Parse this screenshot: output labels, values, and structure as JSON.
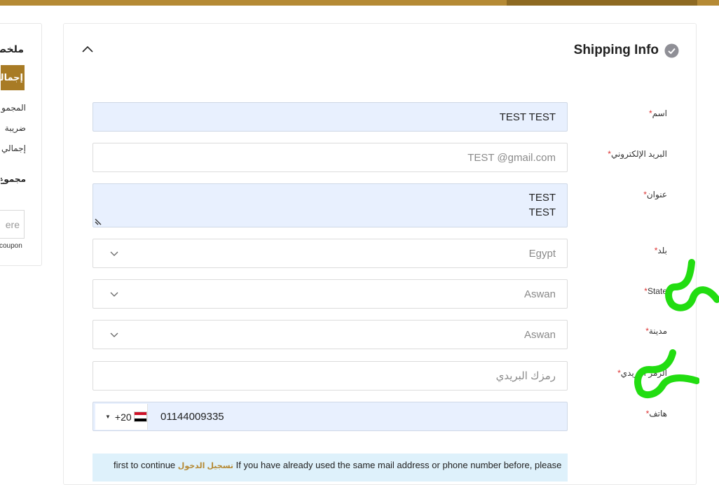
{
  "colors": {
    "brand": "#b58a35",
    "brand_dark": "#8e6a22",
    "autofill": "#e8f0fe",
    "required": "#d33333",
    "annotation": "#22dd11"
  },
  "summary": {
    "title": "ملخص",
    "total_button": "إجمالي",
    "lines": [
      "المجموع",
      "ضريبة",
      "إجمالي"
    ],
    "bold_line": "مجموع",
    "coupon_placeholder": "ere",
    "coupon_text": "coupon"
  },
  "section": {
    "title": "Shipping Info"
  },
  "fields": {
    "name": {
      "label": "اسم",
      "value": "TEST TEST"
    },
    "email": {
      "label": "البريد الإلكتروني",
      "value": "TEST @gmail.com"
    },
    "address": {
      "label": "عنوان",
      "lines": [
        "TEST",
        "TEST"
      ]
    },
    "country": {
      "label": "بلد",
      "value": "Egypt"
    },
    "state": {
      "label": "State",
      "value": "Aswan"
    },
    "city": {
      "label": "مدينة",
      "value": "Aswan"
    },
    "postal": {
      "label": "الرمز البريدي",
      "placeholder": "رمزك البريدي"
    },
    "phone": {
      "label": "هاتف",
      "code": "+20",
      "value": "01144009335"
    }
  },
  "required_mark": "*",
  "notice": {
    "prefix": "first to continue ",
    "link": "تسجيل الدخول",
    "suffix": " If you have already used the same mail address or phone number before, please"
  }
}
